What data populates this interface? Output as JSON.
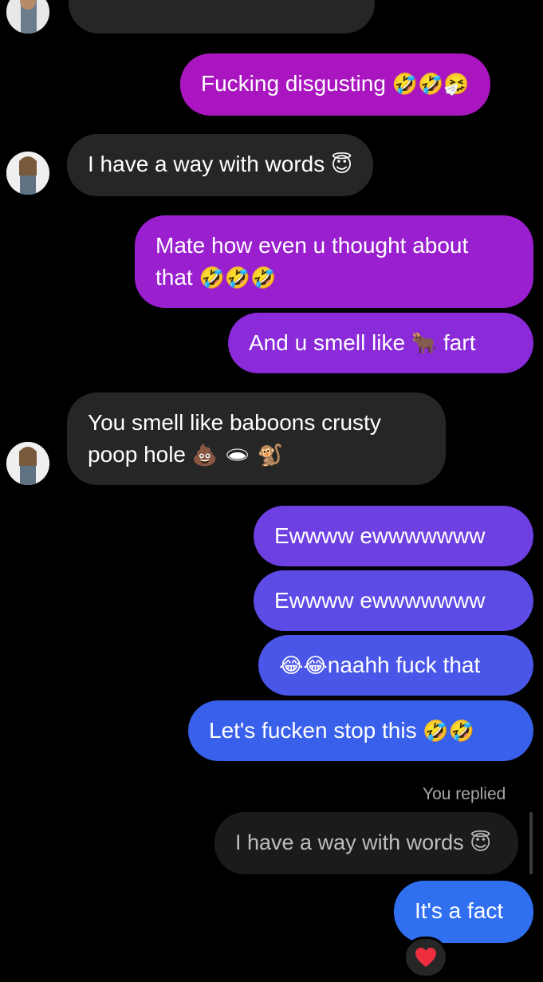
{
  "messages": [
    {
      "id": "m0",
      "dir": "in",
      "text": "",
      "cut": true
    },
    {
      "id": "m1",
      "dir": "out",
      "text": "Fucking disgusting",
      "emoji": "🤣🤣🤧"
    },
    {
      "id": "m2",
      "dir": "in",
      "text": "I have a way with words",
      "emoji": "😇"
    },
    {
      "id": "m3",
      "dir": "out",
      "line1": "Mate how even u thought about",
      "line2": "that",
      "emoji": "🤣🤣🤣"
    },
    {
      "id": "m4",
      "dir": "out",
      "text_a": "And u smell like",
      "emoji": "🐂",
      "text_b": "fart"
    },
    {
      "id": "m5",
      "dir": "in",
      "line1": "You smell like baboons crusty",
      "line2": "poop hole",
      "emoji": "💩 🕳 🐒"
    },
    {
      "id": "m6",
      "dir": "out",
      "text": "Ewwww ewwwwwww"
    },
    {
      "id": "m7",
      "dir": "out",
      "text": "Ewwww ewwwwwww"
    },
    {
      "id": "m8",
      "dir": "out",
      "emoji": "😂😂",
      "text": "naahh fuck that"
    },
    {
      "id": "m9",
      "dir": "out",
      "text": "Let's fucken stop this",
      "emoji": "🤣🤣"
    },
    {
      "id": "m10",
      "dir": "out",
      "text": "It's a fact"
    }
  ],
  "reply": {
    "label": "You replied",
    "quoted_text": "I have a way with words",
    "quoted_emoji": "😇"
  },
  "reaction": {
    "emoji": "❤️",
    "icon": "heart-icon"
  },
  "colors": {
    "incoming": "#262626",
    "gradient_top": "#a517c6",
    "gradient_bottom": "#2f6bf0",
    "background": "#000000"
  }
}
